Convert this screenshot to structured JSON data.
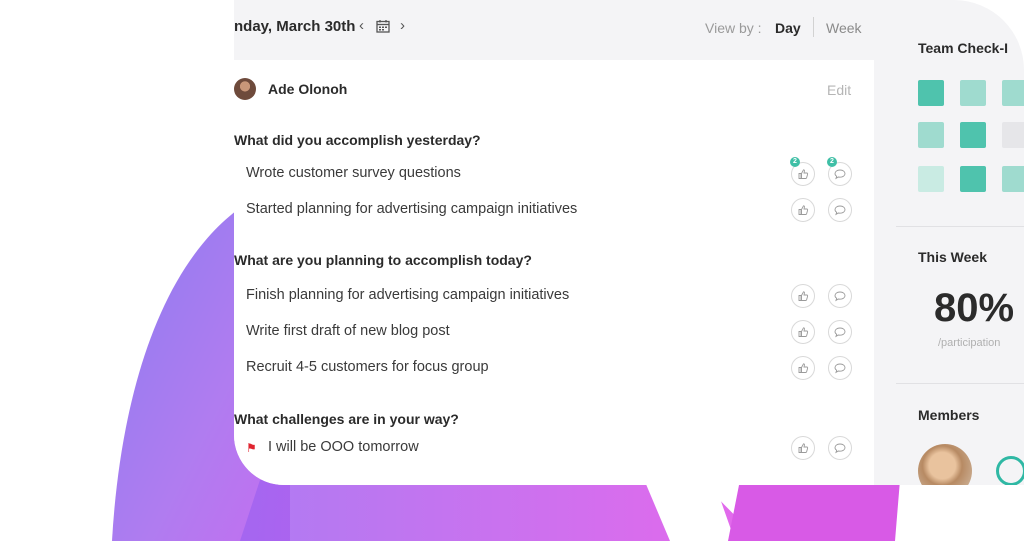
{
  "header": {
    "date": "nday, March 30th",
    "prev_icon": "chevron-left-icon",
    "calendar_icon": "calendar-icon",
    "next_icon": "chevron-right-icon",
    "viewby_label": "View by :",
    "day_label": "Day",
    "week_label": "Week"
  },
  "user": {
    "name": "Ade Olonoh",
    "edit_label": "Edit"
  },
  "sections": [
    {
      "question": "What did you accomplish yesterday?",
      "items": [
        {
          "text": "Wrote customer survey questions",
          "likes": "2",
          "comments": "2"
        },
        {
          "text": "Started planning for advertising campaign initiatives"
        }
      ]
    },
    {
      "question": "What are you planning to accomplish today?",
      "items": [
        {
          "text": "Finish planning for advertising campaign initiatives"
        },
        {
          "text": "Write first draft of new blog post"
        },
        {
          "text": "Recruit 4-5 customers for focus group"
        }
      ]
    },
    {
      "question": "What challenges are in your way?",
      "items": [
        {
          "text": "I will be OOO tomorrow",
          "flag_icon": "red-flag-icon"
        }
      ]
    }
  ],
  "sidebar": {
    "checkin_title": "Team Check-I",
    "week_title": "This Week",
    "participation_value": "80%",
    "participation_label": "/participation",
    "members_title": "Members"
  },
  "colors": {
    "accent": "#3fbfa6",
    "tile_dark": "#4fc3ad",
    "tile_mid": "#9fdbcf",
    "tile_light": "#c9ebe3",
    "flag": "#e0242f"
  }
}
